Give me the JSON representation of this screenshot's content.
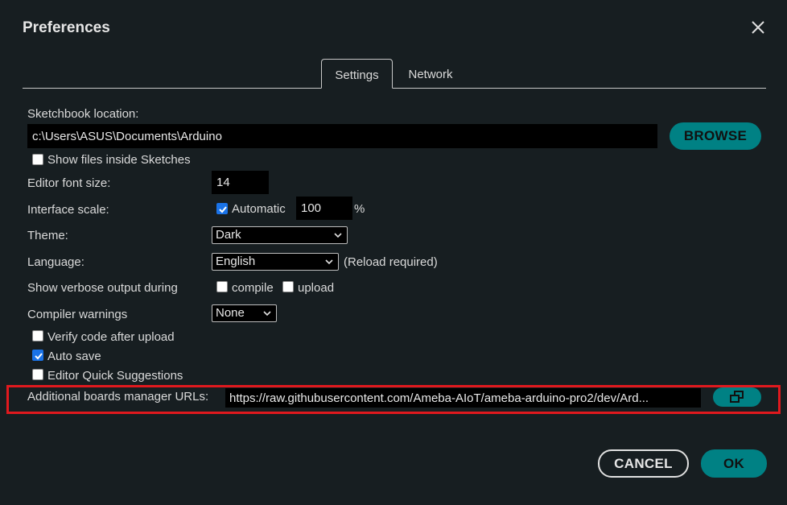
{
  "dialog": {
    "title": "Preferences"
  },
  "tabs": [
    {
      "label": "Settings",
      "active": true
    },
    {
      "label": "Network",
      "active": false
    }
  ],
  "sketchbook": {
    "label": "Sketchbook location:",
    "value": "c:\\Users\\ASUS\\Documents\\Arduino",
    "browse_label": "BROWSE"
  },
  "show_files": {
    "label": "Show files inside Sketches",
    "checked": false
  },
  "editor_font": {
    "label": "Editor font size:",
    "value": "14"
  },
  "interface_scale": {
    "label": "Interface scale:",
    "automatic_label": "Automatic",
    "automatic_checked": true,
    "value": "100",
    "unit": "%"
  },
  "theme": {
    "label": "Theme:",
    "selected": "Dark"
  },
  "language": {
    "label": "Language:",
    "selected": "English",
    "note": "(Reload required)"
  },
  "verbose": {
    "label": "Show verbose output during",
    "compile_label": "compile",
    "compile_checked": false,
    "upload_label": "upload",
    "upload_checked": false
  },
  "compiler_warnings": {
    "label": "Compiler warnings",
    "selected": "None"
  },
  "verify_code": {
    "label": "Verify code after upload",
    "checked": false
  },
  "auto_save": {
    "label": "Auto save",
    "checked": true
  },
  "quick_suggestions": {
    "label": "Editor Quick Suggestions",
    "checked": false
  },
  "boards_urls": {
    "label": "Additional boards manager URLs:",
    "value": "https://raw.githubusercontent.com/Ameba-AIoT/ameba-arduino-pro2/dev/Ard..."
  },
  "footer": {
    "cancel_label": "CANCEL",
    "ok_label": "OK"
  },
  "colors": {
    "background": "#171e21",
    "accent": "#008184",
    "highlight_border": "#e0191e",
    "checkbox_checked": "#1a73e8"
  }
}
